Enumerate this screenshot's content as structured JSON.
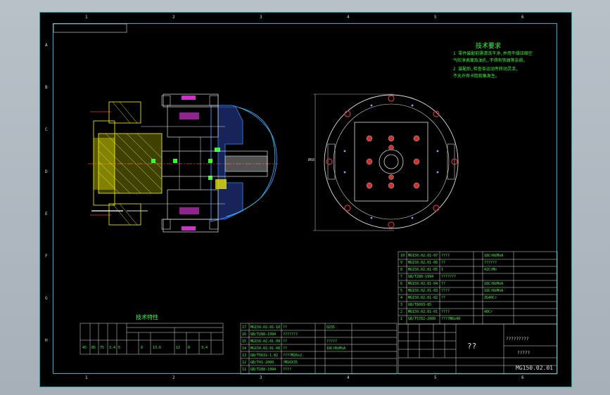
{
  "tech_req": {
    "title": "技术要求",
    "line1": "1 零件装配前需清洗干净,并用干燥压缩空",
    "line2": "气吹净表面及油孔,不得有铁屑等杂质。",
    "line3": "2 装配后,检查各运动件转动灵活,",
    "line4": "不允许有卡阻现象发生。"
  },
  "tech_spec": {
    "title": "技术特性",
    "row_a": [
      "45",
      "85",
      "75",
      "3.4",
      "5",
      "",
      "8",
      "13.6",
      "12",
      "8",
      "3.4"
    ]
  },
  "bom_upper": [
    {
      "no": "10",
      "code": "MG150.02.01-07",
      "name": "????",
      "material": "18CrNiMoA"
    },
    {
      "no": "9",
      "code": "MG150.02.01-06",
      "name": "??",
      "material": "??????"
    },
    {
      "no": "8",
      "code": "MG150.02.01-05",
      "name": "1",
      "material": "42CrMo"
    },
    {
      "no": "7",
      "code": "GB/T288-1994",
      "name": "???????",
      "material": ""
    },
    {
      "no": "6",
      "code": "MG150.02.01-04",
      "name": "??",
      "material": "18CrNiMoA"
    },
    {
      "no": "5",
      "code": "MG150.02.01-03",
      "name": "????",
      "material": "18CrNiMoA"
    },
    {
      "no": "4",
      "code": "MG150.02.01-02",
      "name": "??",
      "material": "ZG40Cr"
    },
    {
      "no": "3",
      "code": "GB/T6093-85",
      "name": "",
      "material": ""
    },
    {
      "no": "2",
      "code": "MG150.02.01-01",
      "name": "????",
      "material": "40Cr"
    },
    {
      "no": "1",
      "code": "GB/T5782-2000",
      "name": "????M6x40",
      "material": ""
    }
  ],
  "bom_lower": [
    {
      "no": "17",
      "code": "MG150.02.01-10",
      "name": "??",
      "material": "Q235"
    },
    {
      "no": "16",
      "code": "GB/T288-1994",
      "name": "???????",
      "material": ""
    },
    {
      "no": "15",
      "code": "MG150.02.01-09",
      "name": "??",
      "material": "?????"
    },
    {
      "no": "14",
      "code": "MG150.02.01-08",
      "name": "??",
      "material": "18CrNiMoA"
    },
    {
      "no": "13",
      "code": "GB/T5632-1.82",
      "name": "????M20x2",
      "material": ""
    },
    {
      "no": "12",
      "code": "GB/T41-2000",
      "name": "?M16X35",
      "material": ""
    },
    {
      "no": "11",
      "code": "GB/T288-1994",
      "name": "????",
      "material": ""
    }
  ],
  "title_block": {
    "part_name": "??",
    "unit": "?????????",
    "sub": "?????",
    "drawing_no": "MG150.02.01"
  },
  "ruler_top": [
    "1",
    "2",
    "3",
    "4",
    "5",
    "6"
  ],
  "ruler_side": [
    "A",
    "B",
    "C",
    "D",
    "E",
    "F",
    "G",
    "H"
  ],
  "dim_label": "Ø68"
}
